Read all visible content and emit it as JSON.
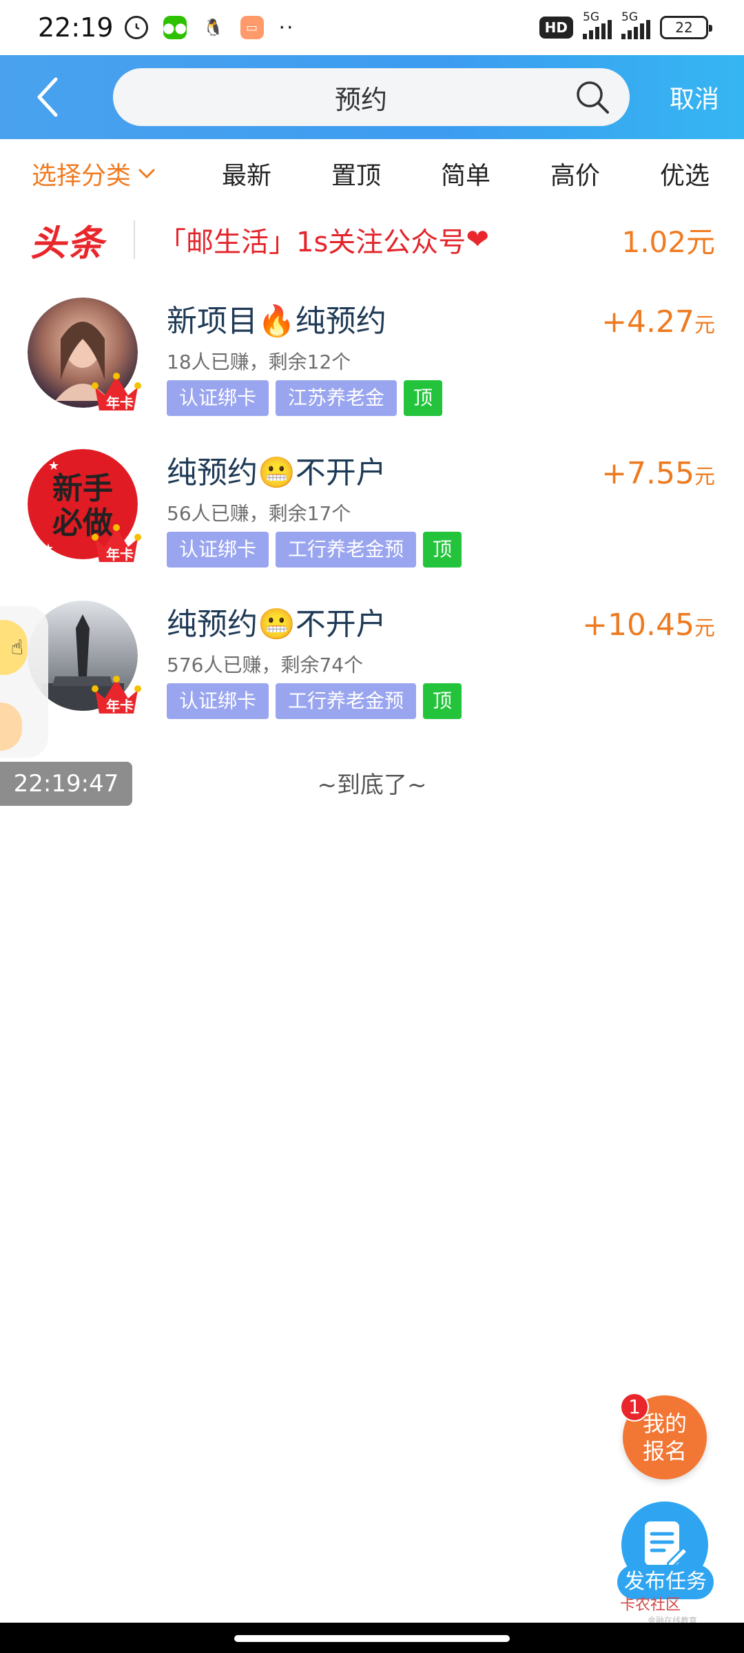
{
  "status_bar": {
    "time": "22:19",
    "hd_label": "HD",
    "network_1": "5G",
    "network_2": "5G",
    "battery": "22"
  },
  "header": {
    "search_value": "预约",
    "cancel_label": "取消"
  },
  "tabs": {
    "category_label": "选择分类",
    "items": [
      "最新",
      "置顶",
      "简单",
      "高价",
      "优选"
    ]
  },
  "headline": {
    "logo": "头条",
    "text": "「邮生活」1s关注公众号",
    "heart_icon": "heart",
    "price": "1.02元"
  },
  "tasks": [
    {
      "title_a": "新项目",
      "emoji": "🔥",
      "title_b": "纯预约",
      "meta": "18人已赚，剩余12个",
      "tags": [
        "认证绑卡",
        "江苏养老金"
      ],
      "top_label": "顶",
      "reward": "+4.27",
      "unit": "元",
      "crown_label": "年卡"
    },
    {
      "title_a": "纯预约",
      "emoji": "😬",
      "title_b": "不开户",
      "meta": "56人已赚，剩余17个",
      "tags": [
        "认证绑卡",
        "工行养老金预"
      ],
      "top_label": "顶",
      "reward": "+7.55",
      "unit": "元",
      "crown_label": "年卡",
      "avatar_text": "新手必做"
    },
    {
      "title_a": "纯预约",
      "emoji": "😬",
      "title_b": "不开户",
      "meta": "576人已赚，剩余74个",
      "tags": [
        "认证绑卡",
        "工行养老金预"
      ],
      "top_label": "顶",
      "reward": "+10.45",
      "unit": "元",
      "crown_label": "年卡"
    }
  ],
  "end_text": "~到底了~",
  "time_toast": "22:19:47",
  "fab": {
    "signup_label": "我的报名",
    "signup_badge": "1",
    "publish_label": "发布任务"
  },
  "watermark": {
    "name": "卡农社区",
    "sub": "金融在线教育"
  }
}
